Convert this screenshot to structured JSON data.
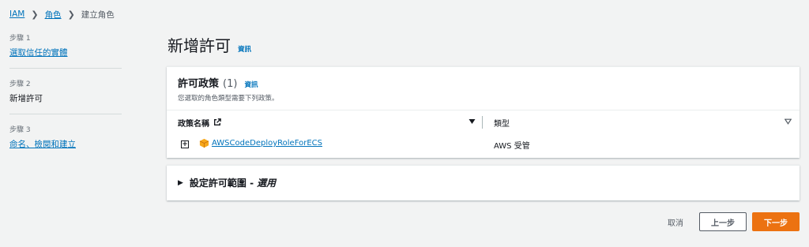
{
  "breadcrumb": {
    "items": [
      "IAM",
      "角色",
      "建立角色"
    ]
  },
  "steps": [
    {
      "num": "步驟 1",
      "title": "選取信任的實體"
    },
    {
      "num": "步驟 2",
      "title": "新增許可"
    },
    {
      "num": "步驟 3",
      "title": "命名、檢閱和建立"
    }
  ],
  "page": {
    "title": "新增許可",
    "info": "資訊"
  },
  "policies": {
    "title": "許可政策",
    "count": "(1)",
    "info": "資訊",
    "description": "您選取的角色類型需要下列政策。",
    "columns": [
      "政策名稱",
      "類型"
    ],
    "rows": [
      {
        "name": "AWSCodeDeployRoleForECS",
        "type": "AWS 受管"
      }
    ]
  },
  "scope": {
    "title": "設定許可範圍 -",
    "optional": "選用"
  },
  "footer": {
    "cancel": "取消",
    "prev": "上一步",
    "next": "下一步"
  },
  "colors": {
    "link": "#0073bb",
    "accent": "#ec7211",
    "background": "#f2f3f3"
  },
  "icons": {
    "external": "external-link-icon",
    "sort": "sort-down-icon",
    "expand": "plus-square-icon",
    "aws_managed": "aws-cube-icon",
    "caret": "caret-right-icon"
  }
}
